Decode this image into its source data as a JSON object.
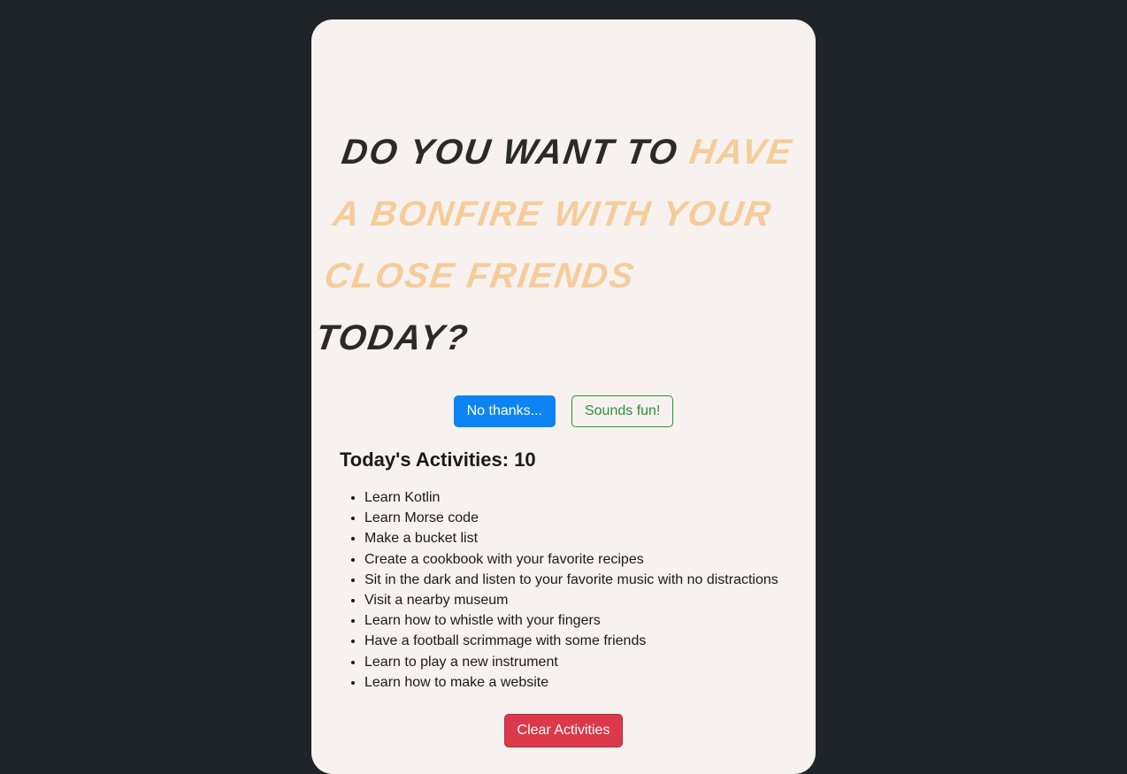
{
  "prompt": {
    "prefix": "Do you want to ",
    "activity": "Have a bonfire with your close friends",
    "suffix": " today?"
  },
  "buttons": {
    "no": "No thanks...",
    "yes": "Sounds fun!",
    "clear": "Clear Activities"
  },
  "activities_header": {
    "label": "Today's Activities: ",
    "count": "10"
  },
  "activities": [
    "Learn Kotlin",
    "Learn Morse code",
    "Make a bucket list",
    "Create a cookbook with your favorite recipes",
    "Sit in the dark and listen to your favorite music with no distractions",
    "Visit a nearby museum",
    "Learn how to whistle with your fingers",
    "Have a football scrimmage with some friends",
    "Learn to play a new instrument",
    "Learn how to make a website"
  ]
}
